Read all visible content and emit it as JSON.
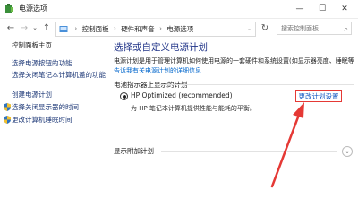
{
  "window": {
    "title": "电源选项",
    "controls": {
      "minimize": "—",
      "maximize": "☐",
      "close": "✕"
    }
  },
  "address_bar": {
    "back": "←",
    "forward": "→",
    "recent": "⌄",
    "up": "↑",
    "breadcrumb": [
      "控制面板",
      "硬件和声音",
      "电源选项"
    ],
    "separator": "›",
    "refresh": "↻",
    "search_placeholder": "搜索控制面板"
  },
  "sidebar": {
    "home": "控制面板主页",
    "links": [
      {
        "label": "选择电源按钮的功能",
        "shield": false
      },
      {
        "label": "选择关闭笔记本计算机盖的功能",
        "shield": false
      },
      {
        "label": "创建电源计划",
        "shield": false
      },
      {
        "label": "选择关闭显示器的时间",
        "shield": true
      },
      {
        "label": "更改计算机睡眠时间",
        "shield": true
      }
    ]
  },
  "main": {
    "heading": "选择或自定义电源计划",
    "description": "电源计划是用于管理计算机如何使用电源的一套硬件和系统设置(如显示器亮度、睡眠等",
    "description_link": "告诉我有关电源计划的详细信息",
    "section_title": "电池指示器上显示的计划",
    "plan": {
      "name": "HP Optimized (recommended)",
      "description": "为 HP 笔记本计算机提供性能与能耗的平衡。",
      "selected": true
    },
    "change_link": "更改计划设置",
    "extra_section": "显示附加计划",
    "expand_icon": "⌄"
  },
  "colors": {
    "heading": "#1e3287",
    "link": "#1f3a78",
    "highlight_box": "#e53935",
    "arrow": "#e53935"
  }
}
